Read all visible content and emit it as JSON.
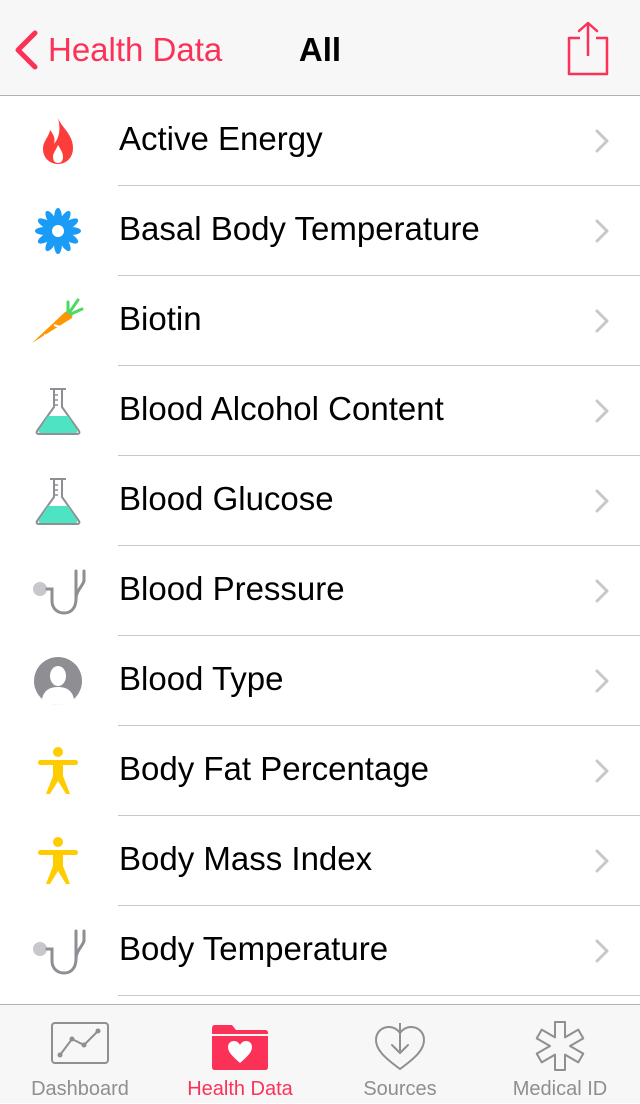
{
  "nav": {
    "back_label": "Health Data",
    "title": "All",
    "share_icon": "share-icon",
    "accent": "#fc3158"
  },
  "items": [
    {
      "label": "Active Energy",
      "icon": "flame-icon"
    },
    {
      "label": "Basal Body Temperature",
      "icon": "flower-icon"
    },
    {
      "label": "Biotin",
      "icon": "carrot-icon"
    },
    {
      "label": "Blood Alcohol Content",
      "icon": "flask-icon"
    },
    {
      "label": "Blood Glucose",
      "icon": "flask-icon"
    },
    {
      "label": "Blood Pressure",
      "icon": "stethoscope-icon"
    },
    {
      "label": "Blood Type",
      "icon": "person-silhouette-icon"
    },
    {
      "label": "Body Fat Percentage",
      "icon": "body-figure-icon"
    },
    {
      "label": "Body Mass Index",
      "icon": "body-figure-icon"
    },
    {
      "label": "Body Temperature",
      "icon": "stethoscope-icon"
    }
  ],
  "tabs": [
    {
      "label": "Dashboard",
      "icon": "dashboard-chart-icon",
      "active": false
    },
    {
      "label": "Health Data",
      "icon": "health-data-folder-icon",
      "active": true
    },
    {
      "label": "Sources",
      "icon": "sources-heart-icon",
      "active": false
    },
    {
      "label": "Medical ID",
      "icon": "medical-star-icon",
      "active": false
    }
  ]
}
